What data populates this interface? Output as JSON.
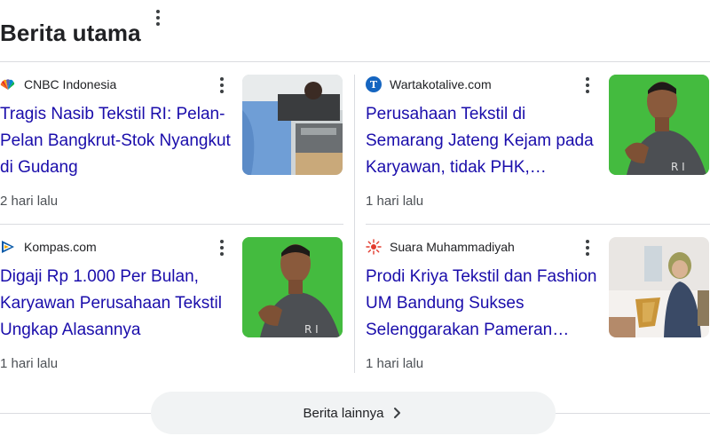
{
  "header": {
    "title": "Berita utama"
  },
  "cards": [
    {
      "source": "CNBC Indonesia",
      "source_logo": "cnbc-peacock-logo",
      "headline": "Tragis Nasib Tekstil RI: Pelan-Pelan Bangkrut-Stok Nyangkut di Gudang",
      "time": "2 hari lalu",
      "thumbnail": "textile-factory-worker-sewing-machine"
    },
    {
      "source": "Wartakotalive.com",
      "source_logo": "wartakota-t-logo",
      "headline": "Perusahaan Tekstil di Semarang Jateng Kejam pada Karyawan, tidak PHK,…",
      "time": "1 hari lalu",
      "thumbnail": "man-green-screen-portrait"
    },
    {
      "source": "Kompas.com",
      "source_logo": "kompas-logo",
      "headline": "Digaji Rp 1.000 Per Bulan, Karyawan Perusahaan Tekstil Ungkap Alasannya",
      "time": "1 hari lalu",
      "thumbnail": "man-green-screen-portrait"
    },
    {
      "source": "Suara Muhammadiyah",
      "source_logo": "suara-muhammadiyah-logo",
      "headline": "Prodi Kriya Tekstil dan Fashion UM Bandung Sukses Selenggarakan Pameran…",
      "time": "1 hari lalu",
      "thumbnail": "woman-textile-exhibition"
    }
  ],
  "more_button": {
    "label": "Berita lainnya"
  },
  "colors": {
    "headline_link": "#1a0dab",
    "text": "#202124",
    "muted": "#4d5156",
    "divider": "#dadce0",
    "button_bg": "#f1f3f4"
  }
}
